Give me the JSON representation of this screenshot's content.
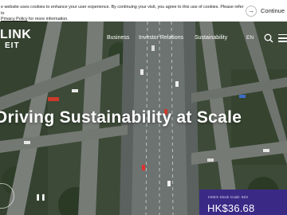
{
  "cookie": {
    "line1": "e website uses cookies to enhance your user experience. By continuing your visit, you agree to this use of cookies. Please refer to",
    "policy_link": "Privacy Policy",
    "line2_rest": " for more information.",
    "continue_label": "Continue",
    "continue_icon": "arrow-right-icon"
  },
  "header": {
    "logo_line1": "LINK",
    "logo_line2": "EIT",
    "nav": [
      "Business",
      "Investor Relations",
      "Sustainability"
    ],
    "language": "EN",
    "search_icon": "search-icon",
    "menu_icon": "hamburger-menu-icon"
  },
  "hero": {
    "headline": "Driving Sustainability at Scale",
    "pause_icon": "pause-icon"
  },
  "stock": {
    "code_label": "HKEX Stock Code: 823",
    "price": "HK$36.68"
  },
  "colors": {
    "stock_card": "#3a2a86",
    "banner_bg": "#ffffff"
  }
}
